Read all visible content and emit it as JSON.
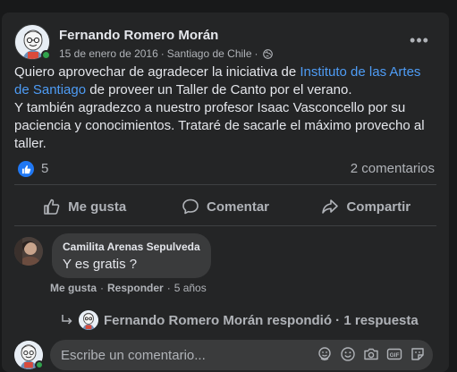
{
  "post": {
    "author": "Fernando Romero Morán",
    "date": "15 de enero de 2016",
    "separator": "·",
    "location": "Santiago de Chile",
    "separator2": "·",
    "more_label": "•••",
    "text_part1": "Quiero aprovechar de agradecer la iniciativa de ",
    "link_text": "Instituto de las Artes de Santiago",
    "text_part2": " de proveer un Taller de Canto por el verano.",
    "text_line2": "Y también agradezco a nuestro profesor Isaac Vasconcello por su paciencia y conocimientos. Trataré de sacarle el máximo provecho al taller."
  },
  "stats": {
    "likes": "5",
    "comments": "2 comentarios"
  },
  "actions": {
    "like": "Me gusta",
    "comment": "Comentar",
    "share": "Compartir"
  },
  "comment": {
    "author": "Camilita Arenas Sepulveda",
    "text": "Y es gratis ?",
    "like": "Me gusta",
    "dot1": "·",
    "reply": "Responder",
    "dot2": "·",
    "time": "5 años"
  },
  "reply_summary": {
    "text": "Fernando Romero Morán respondió · 1 respuesta"
  },
  "composer": {
    "placeholder": "Escribe un comentario..."
  },
  "colors": {
    "background": "#18191a",
    "card": "#242526",
    "link": "#4e9cf5",
    "like_blue": "#2078f4",
    "online_green": "#31a24c"
  }
}
